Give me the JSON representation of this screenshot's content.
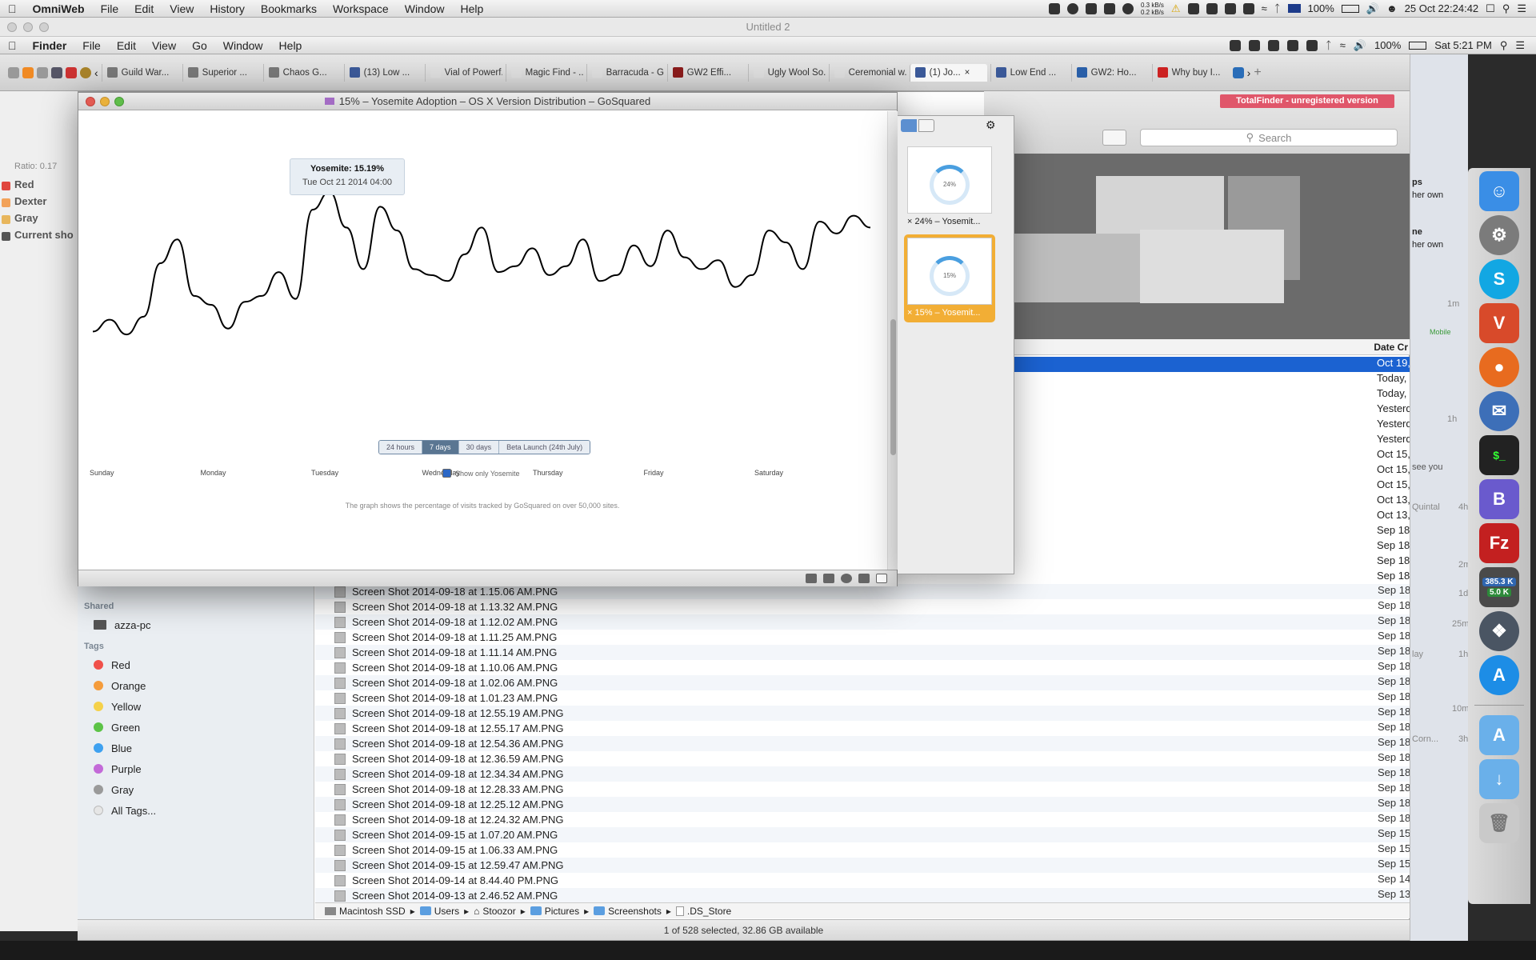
{
  "menubar": {
    "app": "OmniWeb",
    "items": [
      "File",
      "Edit",
      "View",
      "History",
      "Bookmarks",
      "Workspace",
      "Window",
      "Help"
    ],
    "net_up": "0.3 kB/s",
    "net_down": "0.2 kB/s",
    "battery": "100%",
    "clock": "25 Oct  22:24:42"
  },
  "bg_window_title": "Untitled 2",
  "menubar2": {
    "app": "Finder",
    "items": [
      "File",
      "Edit",
      "View",
      "Go",
      "Window",
      "Help"
    ],
    "battery": "100%",
    "clock": "Sat 5:21 PM"
  },
  "tabs": [
    {
      "label": "Guild War..."
    },
    {
      "label": "Superior ..."
    },
    {
      "label": "Chaos G..."
    },
    {
      "label": "(13) Low ..."
    },
    {
      "label": "Vial of Powerf..."
    },
    {
      "label": "Magic Find - ..."
    },
    {
      "label": "Barracuda - G..."
    },
    {
      "label": "GW2 Effi..."
    },
    {
      "label": "Ugly Wool So..."
    },
    {
      "label": "Ceremonial w..."
    },
    {
      "label": "(1) Jo..."
    },
    {
      "label": "Low End ..."
    },
    {
      "label": "GW2: Ho..."
    },
    {
      "label": "Why buy I..."
    }
  ],
  "left_panel": {
    "ratio": "Ratio: 0.17",
    "items": [
      {
        "label": "Red",
        "color": "#e0463e"
      },
      {
        "label": "Dexter",
        "color": "#f2a25a"
      },
      {
        "label": "Gray",
        "color": "#e8b65c"
      },
      {
        "label": "Current sho",
        "color": "#555555"
      }
    ]
  },
  "browser_window": {
    "title": "15% – Yosemite Adoption – OS X Version Distribution – GoSquared",
    "tooltip_title": "Yosemite: 15.19%",
    "tooltip_date": "Tue Oct 21 2014 04:00",
    "range_buttons": [
      "24 hours",
      "7 days",
      "30 days",
      "Beta Launch (24th July)"
    ],
    "range_selected": "7 days",
    "checkbox_label": "Show only Yosemite",
    "footnote": "The graph shows the percentage of visits tracked by GoSquared on over 50,000 sites."
  },
  "chart_data": {
    "type": "line",
    "x_tick_labels": [
      "Sunday",
      "Monday",
      "Tuesday",
      "Wednesday",
      "Thursday",
      "Friday",
      "Saturday"
    ],
    "series": [
      {
        "name": "Yosemite",
        "color": "#000000",
        "values": [
          11.2,
          11.6,
          11.1,
          11.7,
          13.5,
          14.3,
          12.4,
          12.1,
          11.3,
          12.2,
          12.4,
          13.2,
          12.3,
          15.3,
          15.9,
          14.7,
          13.3,
          15.4,
          14.6,
          13.3,
          13.1,
          12.9,
          13.8,
          14.7,
          13.2,
          13.4,
          14.0,
          13.1,
          13.4,
          14.3,
          12.9,
          13.1,
          14.1,
          13.4,
          14.6,
          13.7,
          13.3,
          13.6,
          12.7,
          13.1,
          14.6,
          14.2,
          13.3,
          14.9,
          14.5,
          15.1,
          14.7
        ]
      }
    ],
    "ylim": [
      10,
      17
    ],
    "highlight": {
      "label": "Yosemite: 15.19%",
      "date": "Tue Oct 21 2014 04:00"
    },
    "grid": false
  },
  "thumbnails": [
    {
      "label": "24% – Yosemit...",
      "ring": "24%",
      "selected": false
    },
    {
      "label": "15% – Yosemit...",
      "ring": "15%",
      "selected": true
    }
  ],
  "finder": {
    "badge": "TotalFinder - unregistered version",
    "search_placeholder": "Search",
    "date_header": "Date Cr",
    "date_cells": [
      "Oct 19,",
      "Today,",
      "Today,",
      "Yesterd",
      "Yesterd",
      "Yesterd",
      "Oct 15,",
      "Oct 15,",
      "Oct 15,",
      "Oct 13,",
      "Oct 13,",
      "Sep 18",
      "Sep 18",
      "Sep 18",
      "Sep 18"
    ],
    "sidebar": {
      "shared_header": "Shared",
      "shared_items": [
        "azza-pc"
      ],
      "tags_header": "Tags",
      "tags": [
        {
          "label": "Red",
          "color": "#f0504a"
        },
        {
          "label": "Orange",
          "color": "#f59c3c"
        },
        {
          "label": "Yellow",
          "color": "#f5d14a"
        },
        {
          "label": "Green",
          "color": "#5cc347"
        },
        {
          "label": "Blue",
          "color": "#3ea1f0"
        },
        {
          "label": "Purple",
          "color": "#c36ad8"
        },
        {
          "label": "Gray",
          "color": "#9a9a9a"
        },
        {
          "label": "All Tags...",
          "color": "#e6e6e6"
        }
      ]
    },
    "files": [
      {
        "name": "Screen Shot 2014-09-18 at 1.15.06 AM.PNG",
        "date": "Sep 18"
      },
      {
        "name": "Screen Shot 2014-09-18 at 1.13.32 AM.PNG",
        "date": "Sep 18"
      },
      {
        "name": "Screen Shot 2014-09-18 at 1.12.02 AM.PNG",
        "date": "Sep 18"
      },
      {
        "name": "Screen Shot 2014-09-18 at 1.11.25 AM.PNG",
        "date": "Sep 18"
      },
      {
        "name": "Screen Shot 2014-09-18 at 1.11.14 AM.PNG",
        "date": "Sep 18"
      },
      {
        "name": "Screen Shot 2014-09-18 at 1.10.06 AM.PNG",
        "date": "Sep 18"
      },
      {
        "name": "Screen Shot 2014-09-18 at 1.02.06 AM.PNG",
        "date": "Sep 18"
      },
      {
        "name": "Screen Shot 2014-09-18 at 1.01.23 AM.PNG",
        "date": "Sep 18"
      },
      {
        "name": "Screen Shot 2014-09-18 at 12.55.19 AM.PNG",
        "date": "Sep 18"
      },
      {
        "name": "Screen Shot 2014-09-18 at 12.55.17 AM.PNG",
        "date": "Sep 18"
      },
      {
        "name": "Screen Shot 2014-09-18 at 12.54.36 AM.PNG",
        "date": "Sep 18"
      },
      {
        "name": "Screen Shot 2014-09-18 at 12.36.59 AM.PNG",
        "date": "Sep 18"
      },
      {
        "name": "Screen Shot 2014-09-18 at 12.34.34 AM.PNG",
        "date": "Sep 18"
      },
      {
        "name": "Screen Shot 2014-09-18 at 12.28.33 AM.PNG",
        "date": "Sep 18"
      },
      {
        "name": "Screen Shot 2014-09-18 at 12.25.12 AM.PNG",
        "date": "Sep 18"
      },
      {
        "name": "Screen Shot 2014-09-18 at 12.24.32 AM.PNG",
        "date": "Sep 18"
      },
      {
        "name": "Screen Shot 2014-09-15 at 1.07.20 AM.PNG",
        "date": "Sep 15"
      },
      {
        "name": "Screen Shot 2014-09-15 at 1.06.33 AM.PNG",
        "date": "Sep 15"
      },
      {
        "name": "Screen Shot 2014-09-15 at 12.59.47 AM.PNG",
        "date": "Sep 15"
      },
      {
        "name": "Screen Shot 2014-09-14 at 8.44.40 PM.PNG",
        "date": "Sep 14"
      },
      {
        "name": "Screen Shot 2014-09-13 at 2.46.52 AM.PNG",
        "date": "Sep 13"
      }
    ],
    "path": [
      "Macintosh SSD",
      "Users",
      "Stoozor",
      "Pictures",
      "Screenshots",
      ".DS_Store"
    ],
    "status": "1 of 528 selected, 32.86 GB available"
  },
  "facebook_strip": {
    "lines": [
      "ps",
      "her own",
      "ne",
      "her own",
      "1m",
      "Mobile",
      "1h",
      "see you",
      "Quintal",
      "4h",
      "2m",
      "1d",
      "25m",
      "lay",
      "1h",
      "10m",
      "Corn...",
      "3h"
    ]
  },
  "dock": {
    "items": [
      {
        "name": "finder",
        "color": "#3a8ee6"
      },
      {
        "name": "system-preferences",
        "color": "#7b7b7b"
      },
      {
        "name": "skype",
        "color": "#12a7e3"
      },
      {
        "name": "vivaldi",
        "color": "#d84a2a"
      },
      {
        "name": "firefox",
        "color": "#e86b1f"
      },
      {
        "name": "thunderbird",
        "color": "#3d6fb8"
      },
      {
        "name": "terminal",
        "color": "#222222"
      },
      {
        "name": "bbedit",
        "color": "#6a5acd"
      },
      {
        "name": "filezilla",
        "color": "#c32020"
      },
      {
        "name": "network-meter",
        "color": "#4a4a4a"
      },
      {
        "name": "chatter",
        "color": "#4a5563"
      },
      {
        "name": "app-store",
        "color": "#1d8de6"
      },
      {
        "name": "applications-folder",
        "color": "#6ab0ea"
      },
      {
        "name": "downloads-folder",
        "color": "#6ab0ea"
      },
      {
        "name": "trash",
        "color": "#c9c9c9"
      }
    ],
    "net_meter_up": "385.3 K",
    "net_meter_down": "5.0 K"
  }
}
